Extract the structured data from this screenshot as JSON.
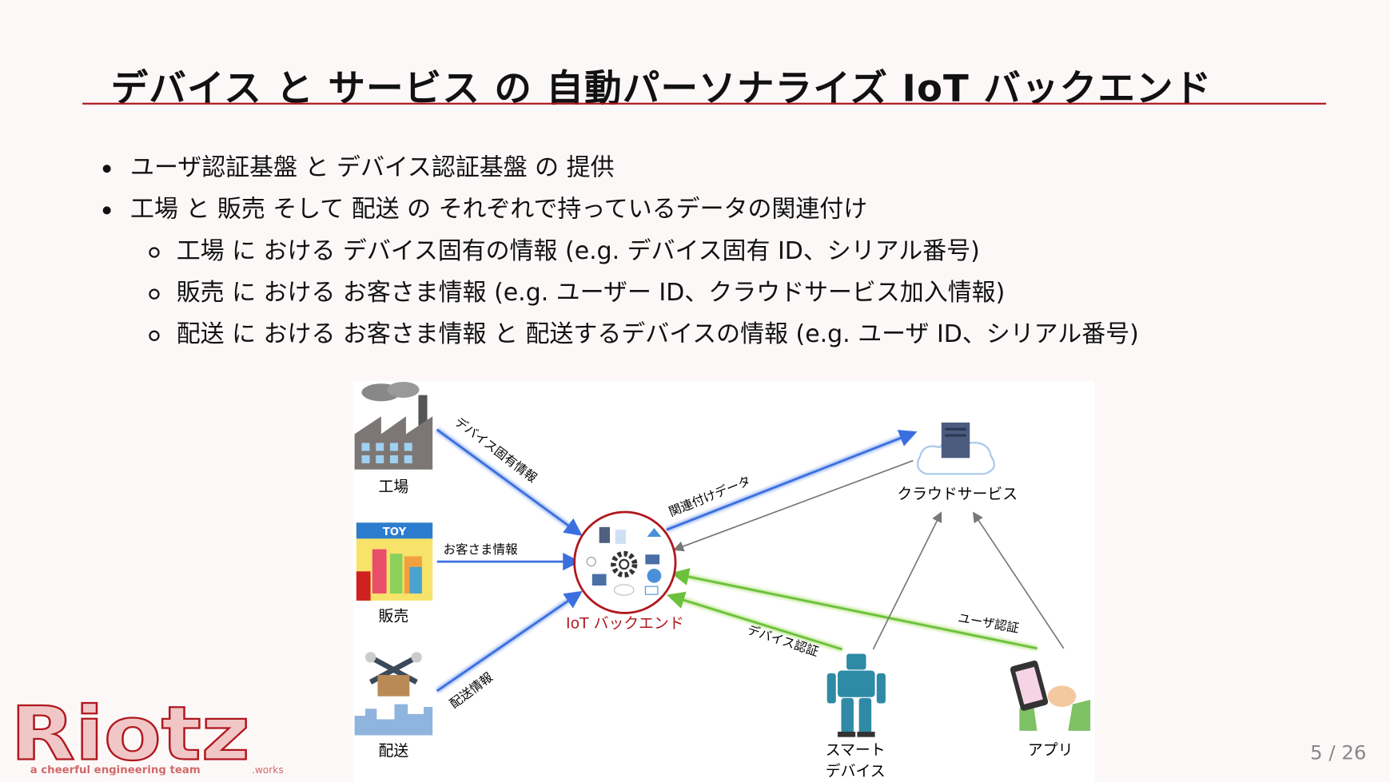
{
  "slide": {
    "title": "デバイス と サービス の 自動パーソナライズ IoT バックエンド",
    "bullets": [
      {
        "level": 1,
        "text": "ユーザ認証基盤 と デバイス認証基盤 の 提供"
      },
      {
        "level": 1,
        "text": "工場 と 販売 そして 配送 の それぞれで持っているデータの関連付け"
      },
      {
        "level": 2,
        "text": "工場 に おける デバイス固有の情報 (e.g. デバイス固有 ID、シリアル番号)"
      },
      {
        "level": 2,
        "text": "販売 に おける お客さま情報 (e.g. ユーザー ID、クラウドサービス加入情報)"
      },
      {
        "level": 2,
        "text": "配送 に おける お客さま情報 と 配送するデバイスの情報 (e.g. ユーザ ID、シリアル番号)"
      }
    ],
    "page_number": "5 / 26"
  },
  "diagram": {
    "nodes": {
      "factory": "工場",
      "sales": "販売",
      "delivery": "配送",
      "backend": "IoT バックエンド",
      "cloud": "クラウドサービス",
      "smart_device_1": "スマート",
      "smart_device_2": "デバイス",
      "app": "アプリ",
      "toy_sign": "TOY"
    },
    "edges": {
      "factory_to_backend": "デバイス固有情報",
      "sales_to_backend": "お客さま情報",
      "delivery_to_backend": "配送情報",
      "backend_to_cloud": "関連付けデータ",
      "device_auth": "デバイス認証",
      "user_auth": "ユーザ認証"
    },
    "colors": {
      "data_flow": "#3b6fe0",
      "auth_flow": "#6cc13c",
      "cloud_flow": "#777777",
      "backend": "#b0171e"
    }
  },
  "logo": {
    "main": "Riotz",
    "tagline": "a cheerful engineering team",
    "suffix": ".works"
  }
}
